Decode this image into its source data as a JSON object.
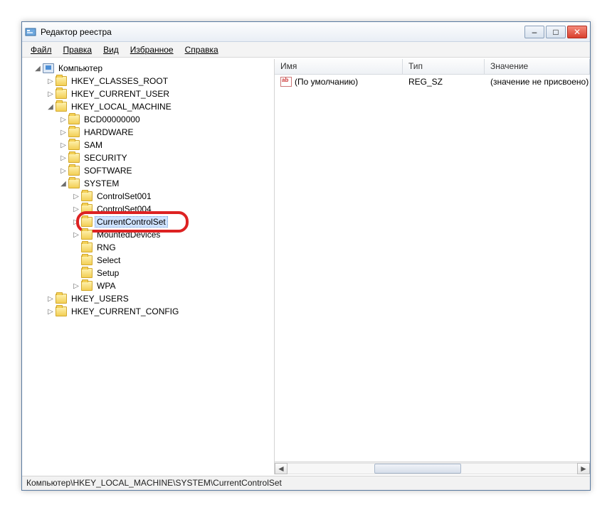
{
  "window": {
    "title": "Редактор реестра"
  },
  "menu": {
    "file": "Файл",
    "edit": "Правка",
    "view": "Вид",
    "favorites": "Избранное",
    "help": "Справка"
  },
  "tree": {
    "root": "Компьютер",
    "hkcr": "HKEY_CLASSES_ROOT",
    "hkcu": "HKEY_CURRENT_USER",
    "hklm": "HKEY_LOCAL_MACHINE",
    "hklm_children": {
      "bcd": "BCD00000000",
      "hardware": "HARDWARE",
      "sam": "SAM",
      "security": "SECURITY",
      "software": "SOFTWARE",
      "system": "SYSTEM"
    },
    "system_children": {
      "cs001": "ControlSet001",
      "cs004": "ControlSet004",
      "ccs": "CurrentControlSet",
      "mounted": "MountedDevices",
      "rng": "RNG",
      "select": "Select",
      "setup": "Setup",
      "wpa": "WPA"
    },
    "hku": "HKEY_USERS",
    "hkcc": "HKEY_CURRENT_CONFIG"
  },
  "list": {
    "columns": {
      "name": "Имя",
      "type": "Тип",
      "value": "Значение"
    },
    "rows": [
      {
        "name": "(По умолчанию)",
        "type": "REG_SZ",
        "value": "(значение не присвоено)"
      }
    ]
  },
  "statusbar": {
    "path": "Компьютер\\HKEY_LOCAL_MACHINE\\SYSTEM\\CurrentControlSet"
  },
  "glyphs": {
    "expand": "▷",
    "collapse": "◢",
    "minimize": "–",
    "maximize": "□",
    "close": "✕",
    "left": "◄",
    "right": "►"
  }
}
